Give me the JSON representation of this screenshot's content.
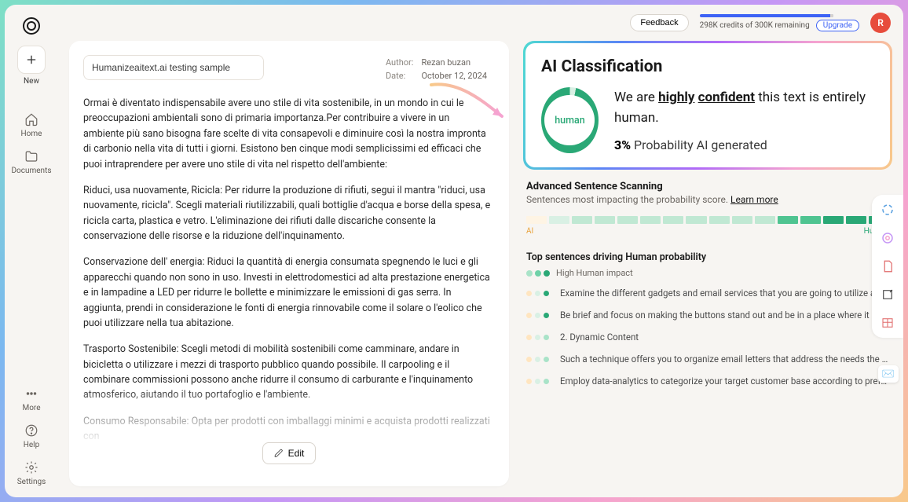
{
  "sidebar": {
    "new_label": "New",
    "home_label": "Home",
    "documents_label": "Documents",
    "more_label": "More",
    "help_label": "Help",
    "settings_label": "Settings"
  },
  "topbar": {
    "feedback_label": "Feedback",
    "credits_text": "298K credits of 300K remaining",
    "upgrade_label": "Upgrade",
    "avatar_initial": "R"
  },
  "editor": {
    "title_value": "Humanizeaitext.ai testing sample",
    "author_label": "Author:",
    "author_value": "Rezan buzan",
    "date_label": "Date:",
    "date_value": "October 12, 2024",
    "paragraphs": [
      "Ormai è diventato indispensabile avere uno stile di vita sostenibile, in un mondo in cui le preoccupazioni ambientali sono di primaria importanza.Per contribuire a vivere in un ambiente più sano bisogna fare scelte di vita consapevoli e diminuire così la nostra impronta di carbonio nella vita di tutti i giorni. Esistono ben cinque modi semplicissimi ed efficaci che puoi intraprendere per avere uno stile di vita nel rispetto dell'ambiente:",
      "Riduci, usa nuovamente, Ricicla: Per ridurre la produzione di rifiuti, segui il mantra \"riduci, usa nuovamente, ricicla\". Scegli materiali riutilizzabili, quali bottiglie d'acqua e borse della spesa, e ricicla carta, plastica e vetro. L'eliminazione dei rifiuti dalle discariche consente la conservazione delle risorse e la riduzione dell'inquinamento.",
      "Conservazione dell' energia: Riduci la quantità di energia consumata spegnendo le luci e gli apparecchi quando non sono in uso. Investi in elettrodomestici ad alta prestazione energetica e in lampadine a LED per ridurre le bollette e minimizzare le emissioni di gas serra. In aggiunta, prendi in considerazione le fonti di energia rinnovabile come il solare o l'eolico che puoi utilizzare nella tua abitazione.",
      "Trasporto Sostenibile: Scegli metodi di mobilità sostenibili come camminare, andare in bicicletta o utilizzare i mezzi di trasporto pubblico quando possibile. Il carpooling e il combinare commissioni possono anche ridurre il consumo di carburante e l'inquinamento atmosferico, aiutando il tuo portafoglio e l'ambiente.",
      "Consumo Responsabile: Opta per prodotti con imballaggi minimi e acquista prodotti realizzati con"
    ],
    "edit_label": "Edit"
  },
  "classification": {
    "title": "AI Classification",
    "pie_label": "human",
    "line1_pre": "We are ",
    "line1_u1": "highly",
    "line1_space": " ",
    "line1_u2": "confident",
    "line1_post": " this text is entirely human.",
    "pct": "3%",
    "pct_label": " Probability AI generated"
  },
  "scanning": {
    "title": "Advanced Sentence Scanning",
    "subtitle_pre": "Sentences most impacting the probability score. ",
    "learn_more": "Learn more",
    "label_ai": "AI",
    "label_human": "Human",
    "segments": [
      "#fef4e4",
      "#d9f0e4",
      "#c0e8d3",
      "#c0e8d3",
      "#c0e8d3",
      "#c0e8d3",
      "#c0e8d3",
      "#c0e8d3",
      "#c0e8d3",
      "#c0e8d3",
      "#c0e8d3",
      "#4fc491",
      "#4fc491",
      "#2aa876",
      "#2aa876",
      "#2aa876"
    ]
  },
  "top_sentences": {
    "title": "Top sentences driving Human probability",
    "legend": "High Human impact",
    "legend_colors": [
      "#a9e3c8",
      "#6fd1a8",
      "#2aa876"
    ],
    "rows": [
      {
        "dots": [
          "#ffe5c0",
          "#d9f0e4",
          "#2aa876"
        ],
        "text": "Examine the different gadgets and email services that you are going to utilize and assure that..."
      },
      {
        "dots": [
          "#ffe5c0",
          "#d9f0e4",
          "#2aa876"
        ],
        "text": "Be brief and focus on making the buttons stand out and be in a place where it is easy for the..."
      },
      {
        "dots": [
          "#ffe5c0",
          "#d9f0e4",
          "#a9e3c8"
        ],
        "text": "2. Dynamic Content"
      },
      {
        "dots": [
          "#ffe5c0",
          "#d9f0e4",
          "#a9e3c8"
        ],
        "text": "Such a technique offers you to organize email letters that address the needs the best and,..."
      },
      {
        "dots": [
          "#ffe5c0",
          "#d9f0e4",
          "#a9e3c8"
        ],
        "text": "Employ data-analytics to categorize your target customer base according to preferences,..."
      }
    ]
  },
  "chart_data": {
    "type": "pie",
    "title": "AI Classification",
    "series": [
      {
        "name": "Probability AI generated",
        "value": 3
      },
      {
        "name": "Probability Human",
        "value": 97
      }
    ],
    "unit": "%"
  }
}
